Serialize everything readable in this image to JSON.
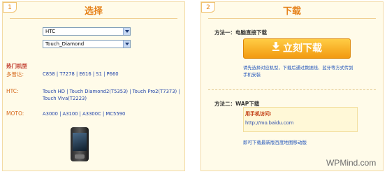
{
  "left_panel": {
    "step_number": "1",
    "title": "选择",
    "brand_select": "HTC",
    "model_select": "Touch_Diamond",
    "hot_models_title": "热门机型",
    "rows": [
      {
        "label": "多普达:",
        "links": "C858 | T7278 | E616 | S1 | P660"
      },
      {
        "label": "HTC:",
        "links": "Touch HD | Touch Diamond2(T5353) | Touch Pro2(T7373) | Touch Viva(T2223)"
      },
      {
        "label": "MOTO:",
        "links": "A3000 | A3100 | A3300C | MC5590"
      }
    ]
  },
  "right_panel": {
    "step_number": "2",
    "title": "下载",
    "method1_label": "方法一：电脑直接下载",
    "download_button": "立刻下载",
    "download_note": "请先选择对应机型，下载后通过数据线、蓝牙等方式传到手机安装",
    "method2_label": "方法二：WAP下载",
    "wap_label": "用手机访问:",
    "wap_url": "http://mo.baidu.com",
    "wap_note": "即可下载最新版百度地图移动版"
  },
  "watermark": "WPMind.com",
  "icons": [
    "dropdown-arrow-icon",
    "download-arrow-icon",
    "phone-image"
  ],
  "colors": {
    "accent": "#e6831c",
    "button": "#f29a11",
    "link": "#2244aa"
  }
}
